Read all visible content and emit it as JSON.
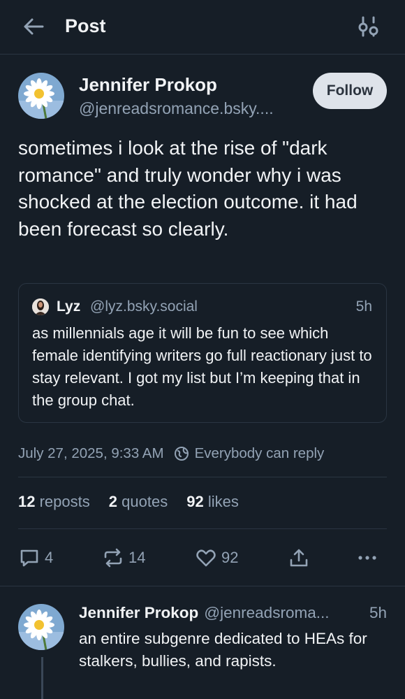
{
  "header": {
    "title": "Post",
    "back_icon": "arrow-left-icon",
    "filter_icon": "sliders-icon"
  },
  "post": {
    "author_name": "Jennifer Prokop",
    "author_handle": "@jenreadsromance.bsky....",
    "follow_label": "Follow",
    "text": "sometimes i look at the rise of \"dark romance\" and truly wonder why i was shocked at the election outcome. it had been forecast so clearly.",
    "quote": {
      "name": "Lyz",
      "handle": "@lyz.bsky.social",
      "time": "5h",
      "text": "as millennials age it will be fun to see which female identifying writers go full reactionary just to stay relevant. I got my list but I’m keeping that in the group chat."
    },
    "timestamp": "July 27, 2025, 9:33 AM",
    "reply_setting": "Everybody can reply",
    "stats": {
      "reposts_count": "12",
      "reposts_label": "reposts",
      "quotes_count": "2",
      "quotes_label": "quotes",
      "likes_count": "92",
      "likes_label": "likes"
    },
    "actions": {
      "replies": "4",
      "reposts": "14",
      "likes": "92"
    }
  },
  "reply": {
    "author_name": "Jennifer Prokop",
    "author_handle": "@jenreadsroma...",
    "time": "5h",
    "text": "an entire subgenre dedicated to HEAs for stalkers, bullies, and rapists."
  },
  "colors": {
    "background": "#161e27",
    "muted_text": "#93a3b5",
    "border": "#2a3542",
    "follow_bg": "#dee3ea"
  }
}
